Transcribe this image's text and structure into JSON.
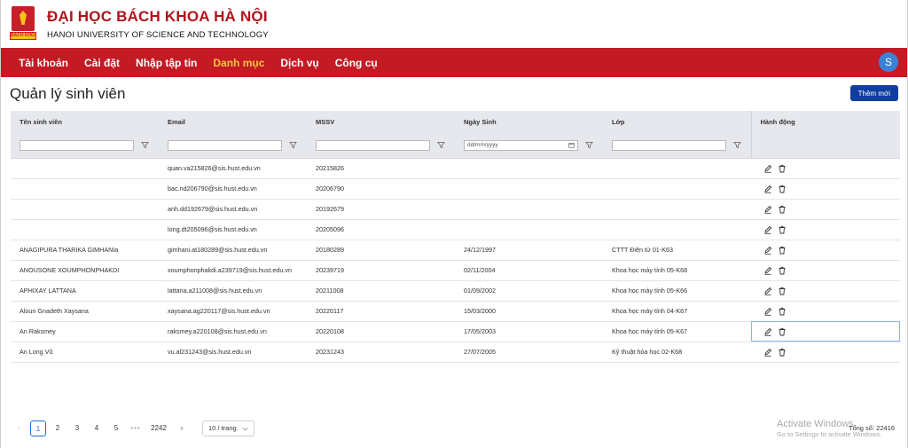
{
  "header": {
    "logo_text": "BÁCH KHOA",
    "title": "ĐẠI HỌC BÁCH KHOA HÀ NỘI",
    "subtitle": "HANOI UNIVERSITY OF SCIENCE AND TECHNOLOGY"
  },
  "nav": {
    "items": [
      {
        "label": "Tài khoản"
      },
      {
        "label": "Cài đặt"
      },
      {
        "label": "Nhập tập tin"
      },
      {
        "label": "Danh mục"
      },
      {
        "label": "Dịch vụ"
      },
      {
        "label": "Công cụ"
      }
    ],
    "active_index": 3,
    "avatar_initial": "S",
    "accent_color": "#c41a24",
    "active_color": "#f7c63d"
  },
  "page": {
    "title": "Quản lý sinh viên",
    "add_button": "Thêm mới"
  },
  "table": {
    "columns": [
      "Tên sinh viên",
      "Email",
      "MSSV",
      "Ngày Sinh",
      "Lớp",
      "Hành động"
    ],
    "date_placeholder": "dd/mm/yyyy",
    "rows": [
      {
        "name": "",
        "email": "quan.va215826@sis.hust.edu.vn",
        "mssv": "20215826",
        "dob": "",
        "class": ""
      },
      {
        "name": "",
        "email": "bac.nd206790@sis.hust.edu.vn",
        "mssv": "20206790",
        "dob": "",
        "class": ""
      },
      {
        "name": "",
        "email": "anh.dd192679@sis.hust.edu.vn",
        "mssv": "20192679",
        "dob": "",
        "class": ""
      },
      {
        "name": "",
        "email": "long.dt205096@sis.hust.edu.vn",
        "mssv": "20205096",
        "dob": "",
        "class": ""
      },
      {
        "name": "ANAGIPURA THARIKA GIMHANIa",
        "email": "gimhani.at180289@sis.hust.edu.vn",
        "mssv": "20180289",
        "dob": "24/12/1997",
        "class": "CTTT Điện tử 01-K63"
      },
      {
        "name": "ANOUSONE XOUMPHONPHAKDI",
        "email": "xoumphonphakdi.a239719@sis.hust.edu.vn",
        "mssv": "20239719",
        "dob": "02/11/2004",
        "class": "Khoa học máy tính 05-K68"
      },
      {
        "name": "APHIXAY LATTANA",
        "email": "lattana.a211008@sis.hust.edu.vn",
        "mssv": "20211008",
        "dob": "01/09/2002",
        "class": "Khoa học máy tính 05-K66"
      },
      {
        "name": "Aloun Gnadeth Xaysana",
        "email": "xaysana.ag220117@sis.hust.edu.vn",
        "mssv": "20220117",
        "dob": "15/03/2000",
        "class": "Khoa học máy tính 04-K67"
      },
      {
        "name": "An Raksmey",
        "email": "raksmey.a220108@sis.hust.edu.vn",
        "mssv": "20220108",
        "dob": "17/05/2003",
        "class": "Khoa học máy tính 05-K67"
      },
      {
        "name": "An Long Vũ",
        "email": "vu.al231243@sis.hust.edu.vn",
        "mssv": "20231243",
        "dob": "27/07/2005",
        "class": "Kỹ thuật hóa học 02-K68"
      }
    ],
    "selected_row": 8
  },
  "pagination": {
    "prev": "‹",
    "pages": [
      "1",
      "2",
      "3",
      "4",
      "5"
    ],
    "ellipsis": "•••",
    "last_page": "2242",
    "next": "›",
    "current": "1",
    "page_size": "10 / trang",
    "total": "Tổng số: 22416"
  },
  "watermark": {
    "line1": "Activate Windows",
    "line2": "Go to Settings to activate Windows."
  }
}
